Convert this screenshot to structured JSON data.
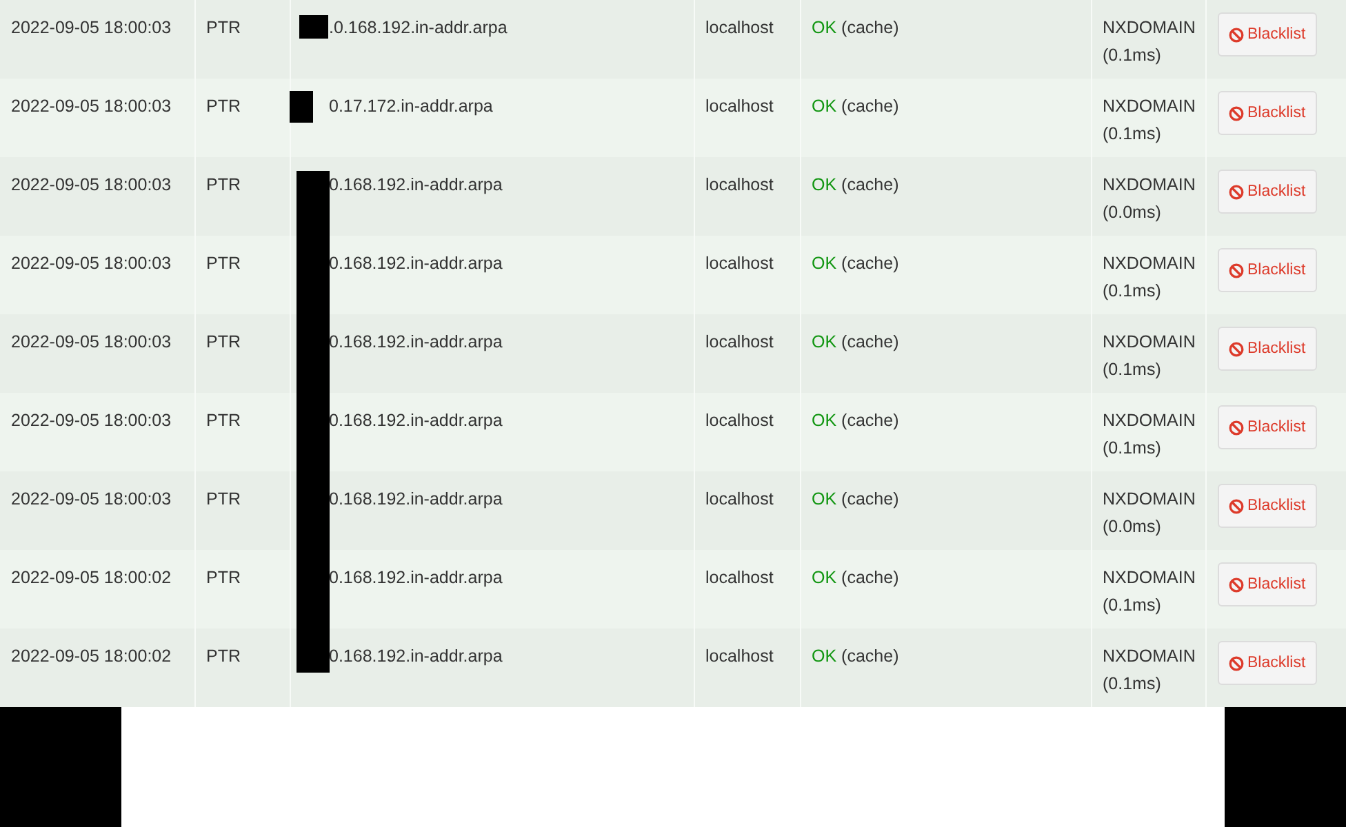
{
  "rows": [
    {
      "time": "2022-09-05 18:00:03",
      "type": "PTR",
      "domain": ".0.168.192.in-addr.arpa",
      "client": "localhost",
      "status": "OK",
      "status_detail": "(cache)",
      "reply": "NXDOMAIN",
      "reply_time": "(0.1ms)",
      "action": "Blacklist"
    },
    {
      "time": "2022-09-05 18:00:03",
      "type": "PTR",
      "domain": "0.17.172.in-addr.arpa",
      "client": "localhost",
      "status": "OK",
      "status_detail": "(cache)",
      "reply": "NXDOMAIN",
      "reply_time": "(0.1ms)",
      "action": "Blacklist"
    },
    {
      "time": "2022-09-05 18:00:03",
      "type": "PTR",
      "domain": "0.168.192.in-addr.arpa",
      "client": "localhost",
      "status": "OK",
      "status_detail": "(cache)",
      "reply": "NXDOMAIN",
      "reply_time": "(0.0ms)",
      "action": "Blacklist"
    },
    {
      "time": "2022-09-05 18:00:03",
      "type": "PTR",
      "domain": "0.168.192.in-addr.arpa",
      "client": "localhost",
      "status": "OK",
      "status_detail": "(cache)",
      "reply": "NXDOMAIN",
      "reply_time": "(0.1ms)",
      "action": "Blacklist"
    },
    {
      "time": "2022-09-05 18:00:03",
      "type": "PTR",
      "domain": "0.168.192.in-addr.arpa",
      "client": "localhost",
      "status": "OK",
      "status_detail": "(cache)",
      "reply": "NXDOMAIN",
      "reply_time": "(0.1ms)",
      "action": "Blacklist"
    },
    {
      "time": "2022-09-05 18:00:03",
      "type": "PTR",
      "domain": "0.168.192.in-addr.arpa",
      "client": "localhost",
      "status": "OK",
      "status_detail": "(cache)",
      "reply": "NXDOMAIN",
      "reply_time": "(0.1ms)",
      "action": "Blacklist"
    },
    {
      "time": "2022-09-05 18:00:03",
      "type": "PTR",
      "domain": "0.168.192.in-addr.arpa",
      "client": "localhost",
      "status": "OK",
      "status_detail": "(cache)",
      "reply": "NXDOMAIN",
      "reply_time": "(0.0ms)",
      "action": "Blacklist"
    },
    {
      "time": "2022-09-05 18:00:02",
      "type": "PTR",
      "domain": "0.168.192.in-addr.arpa",
      "client": "localhost",
      "status": "OK",
      "status_detail": "(cache)",
      "reply": "NXDOMAIN",
      "reply_time": "(0.1ms)",
      "action": "Blacklist"
    },
    {
      "time": "2022-09-05 18:00:02",
      "type": "PTR",
      "domain": "0.168.192.in-addr.arpa",
      "client": "localhost",
      "status": "OK",
      "status_detail": "(cache)",
      "reply": "NXDOMAIN",
      "reply_time": "(0.1ms)",
      "action": "Blacklist"
    }
  ]
}
